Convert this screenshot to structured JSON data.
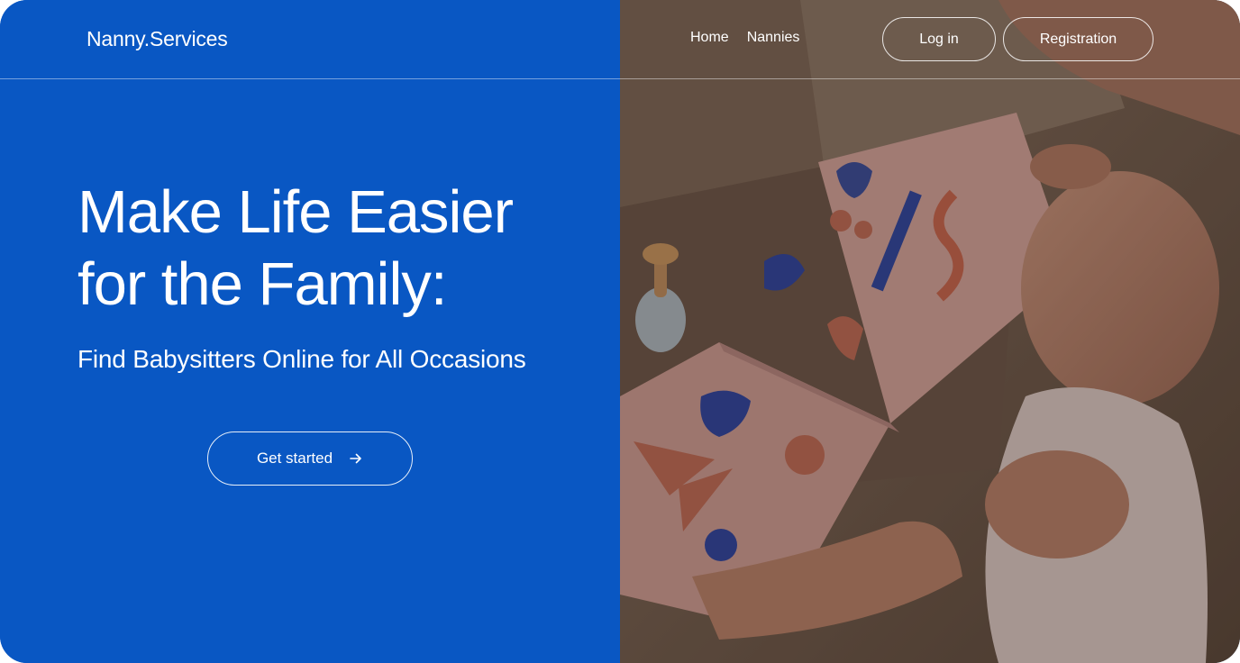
{
  "header": {
    "logo": "Nanny.Services",
    "nav": [
      {
        "label": "Home"
      },
      {
        "label": "Nannies"
      }
    ],
    "login_label": "Log in",
    "register_label": "Registration"
  },
  "hero": {
    "headline_line1": "Make Life Easier",
    "headline_line2": "for the Family:",
    "subtitle": "Find Babysitters Online for All Occasions",
    "cta_label": "Get started",
    "cta_icon": "arrow-right-icon"
  },
  "colors": {
    "primary": "#0957c3",
    "text": "#ffffff"
  }
}
